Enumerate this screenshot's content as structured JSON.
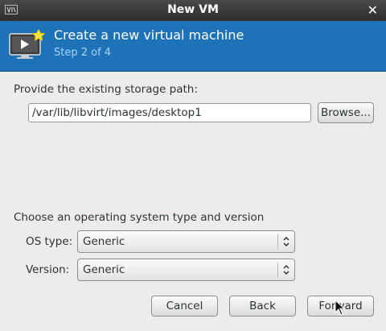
{
  "window": {
    "title": "New VM",
    "close_icon": "close-icon",
    "app_icon": "virt-manager-icon"
  },
  "banner": {
    "heading": "Create a new virtual machine",
    "step": "Step 2 of 4",
    "icon": "new-vm-icon",
    "color": "#1e73b8"
  },
  "storage": {
    "label": "Provide the existing storage path:",
    "path_value": "/var/lib/libvirt/images/desktop1",
    "browse_label": "Browse..."
  },
  "os": {
    "section_label": "Choose an operating system type and version",
    "type_label": "OS type:",
    "type_value": "Generic",
    "version_label": "Version:",
    "version_value": "Generic"
  },
  "buttons": {
    "cancel": "Cancel",
    "back": "Back",
    "forward": "Forward"
  }
}
